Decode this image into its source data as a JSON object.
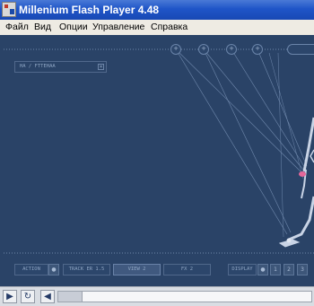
{
  "window": {
    "title": "Millenium Flash Player 4.48"
  },
  "menu": {
    "items": [
      "Файл",
      "Вид",
      "Опции",
      "Управление",
      "Справка"
    ]
  },
  "stage": {
    "tracker_label": "HA / FTTEHAA",
    "tracker_close": "×",
    "node_glyphs": [
      "+",
      "+",
      "+",
      "+"
    ],
    "controls": {
      "action_label": "ACTION",
      "search_label": "TRACK ER 1.5",
      "view2_label": "VIEW 2",
      "fx_label": "FX 2",
      "display_label": "DISPLAY",
      "num1": "1",
      "num2": "2",
      "num3": "3",
      "dot_glyph": "●"
    }
  },
  "player": {
    "play_glyph": "▶",
    "loop_glyph": "↻",
    "back_glyph": "◀"
  },
  "colors": {
    "stage_bg": "#2a4367",
    "title_bar": "#1f55c8",
    "menu_bg": "#eeebe3",
    "skeleton": "#c9d4e6",
    "highlight": "#e5679a"
  }
}
